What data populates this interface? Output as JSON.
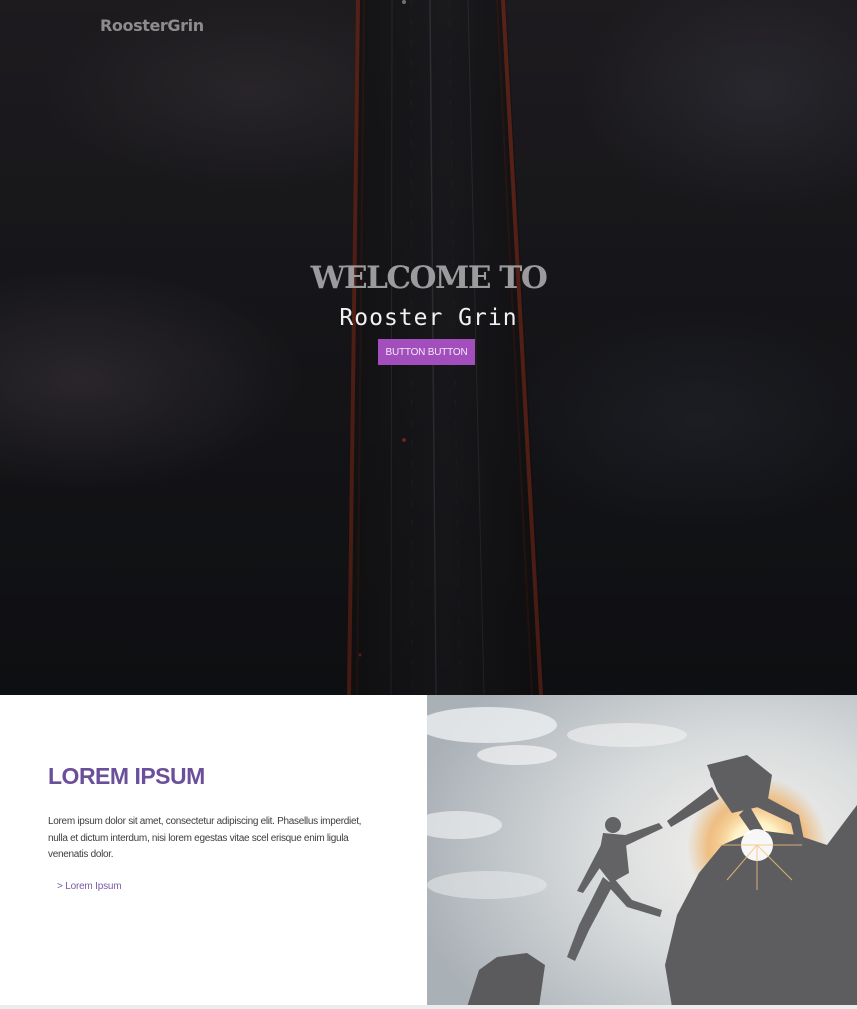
{
  "header": {
    "logo_text": "RoosterGrin"
  },
  "hero": {
    "title": "WELCOME TO",
    "subtitle": "Rooster Grin",
    "button_label": "BUTTON BUTTON",
    "background": "aerial-bridge-in-fog-photo"
  },
  "feature": {
    "heading": "LOREM IPSUM",
    "body": "Lorem ipsum dolor sit amet, consectetur adipiscing elit. Phasellus imperdiet, nulla et dictum interdum, nisi lorem egestas vitae scel erisque enim ligula venenatis dolor.",
    "link_text": "> Lorem Ipsum",
    "image": "climbers-helping-hand-silhouette-photo"
  },
  "colors": {
    "accent": "#a24fbd",
    "heading": "#6a4f9a",
    "link": "#7c5aa8"
  }
}
